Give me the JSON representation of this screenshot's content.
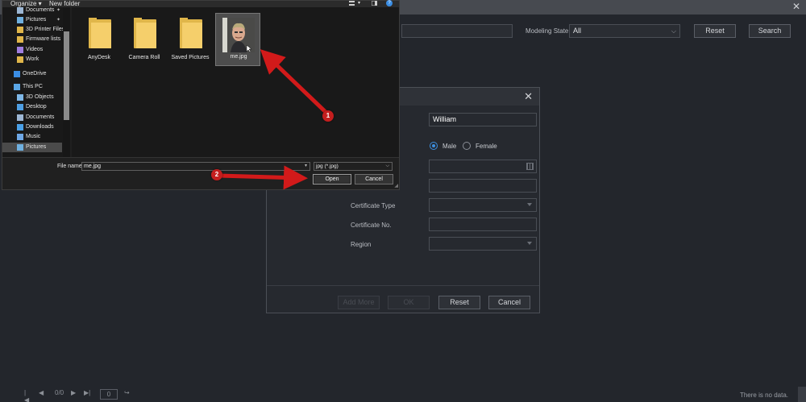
{
  "app": {
    "modeling_state_label": "Modeling State",
    "modeling_state_value": "All",
    "reset_label": "Reset",
    "search_label": "Search",
    "close_symbol": "✕"
  },
  "person_dialog": {
    "name_value": "William",
    "gender_male": "Male",
    "gender_female": "Female",
    "gender_selected": "Male",
    "certificate_type_label": "Certificate Type",
    "certificate_no_label": "Certificate No.",
    "region_label": "Region",
    "add_more_label": "Add More",
    "ok_label": "OK",
    "reset_label": "Reset",
    "cancel_label": "Cancel",
    "close_symbol": "✕"
  },
  "pagination": {
    "page_count": "0/0",
    "page_input": "0",
    "no_data": "There is no data."
  },
  "file_dialog": {
    "organize_label": "Organize ▾",
    "new_folder_label": "New folder",
    "help_symbol": "?",
    "nav_items": [
      {
        "label": "Documents",
        "icon": "documents-icon",
        "pinned": true
      },
      {
        "label": "Pictures",
        "icon": "pictures-icon",
        "pinned": true
      },
      {
        "label": "3D Printer Files",
        "icon": "folder-icon",
        "pinned": false
      },
      {
        "label": "Firmware lists",
        "icon": "folder-icon",
        "pinned": false
      },
      {
        "label": "Videos",
        "icon": "videos-icon",
        "pinned": false
      },
      {
        "label": "Work",
        "icon": "folder-icon",
        "pinned": false
      },
      {
        "label": "OneDrive",
        "icon": "cloud-icon",
        "pinned": false
      },
      {
        "label": "This PC",
        "icon": "pc-icon",
        "pinned": false
      },
      {
        "label": "3D Objects",
        "icon": "cube-icon",
        "pinned": false
      },
      {
        "label": "Desktop",
        "icon": "desktop-icon",
        "pinned": false
      },
      {
        "label": "Documents",
        "icon": "documents-icon",
        "pinned": false
      },
      {
        "label": "Downloads",
        "icon": "downloads-icon",
        "pinned": false
      },
      {
        "label": "Music",
        "icon": "music-icon",
        "pinned": false
      },
      {
        "label": "Pictures",
        "icon": "pictures-icon",
        "pinned": false
      }
    ],
    "files": [
      {
        "label": "AnyDesk",
        "type": "folder"
      },
      {
        "label": "Camera Roll",
        "type": "folder"
      },
      {
        "label": "Saved Pictures",
        "type": "folder"
      },
      {
        "label": "me.jpg",
        "type": "image",
        "selected": true
      }
    ],
    "file_name_label": "File name:",
    "file_name_value": "me.jpg",
    "file_type_value": "jpg (*.jpg)",
    "open_label": "Open",
    "cancel_label": "Cancel",
    "pin_symbol": "📌"
  },
  "annotations": {
    "step1": "1",
    "step2": "2",
    "color": "#d21a1a"
  }
}
